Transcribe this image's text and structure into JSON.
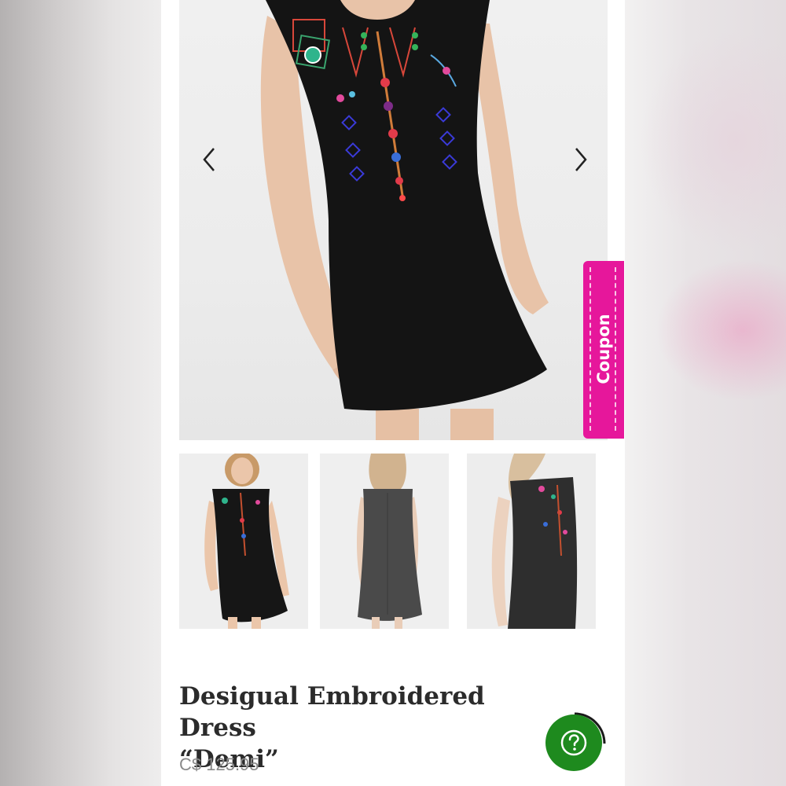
{
  "product": {
    "title_line1": "Desigual Embroidered Dress",
    "title_line2": "“Demi”",
    "price": "C$ 125.95"
  },
  "coupon": {
    "label": "Coupon"
  },
  "gallery": {
    "main_image": "product-photo-front",
    "thumbnails": [
      "thumbnail-front",
      "thumbnail-back",
      "thumbnail-side"
    ]
  },
  "icons": {
    "prev": "chevron-left-icon",
    "next": "chevron-right-icon",
    "help": "question-mark-icon"
  },
  "colors": {
    "coupon": "#e6179b",
    "help_button": "#1e8a1e",
    "dress": "#141414"
  }
}
